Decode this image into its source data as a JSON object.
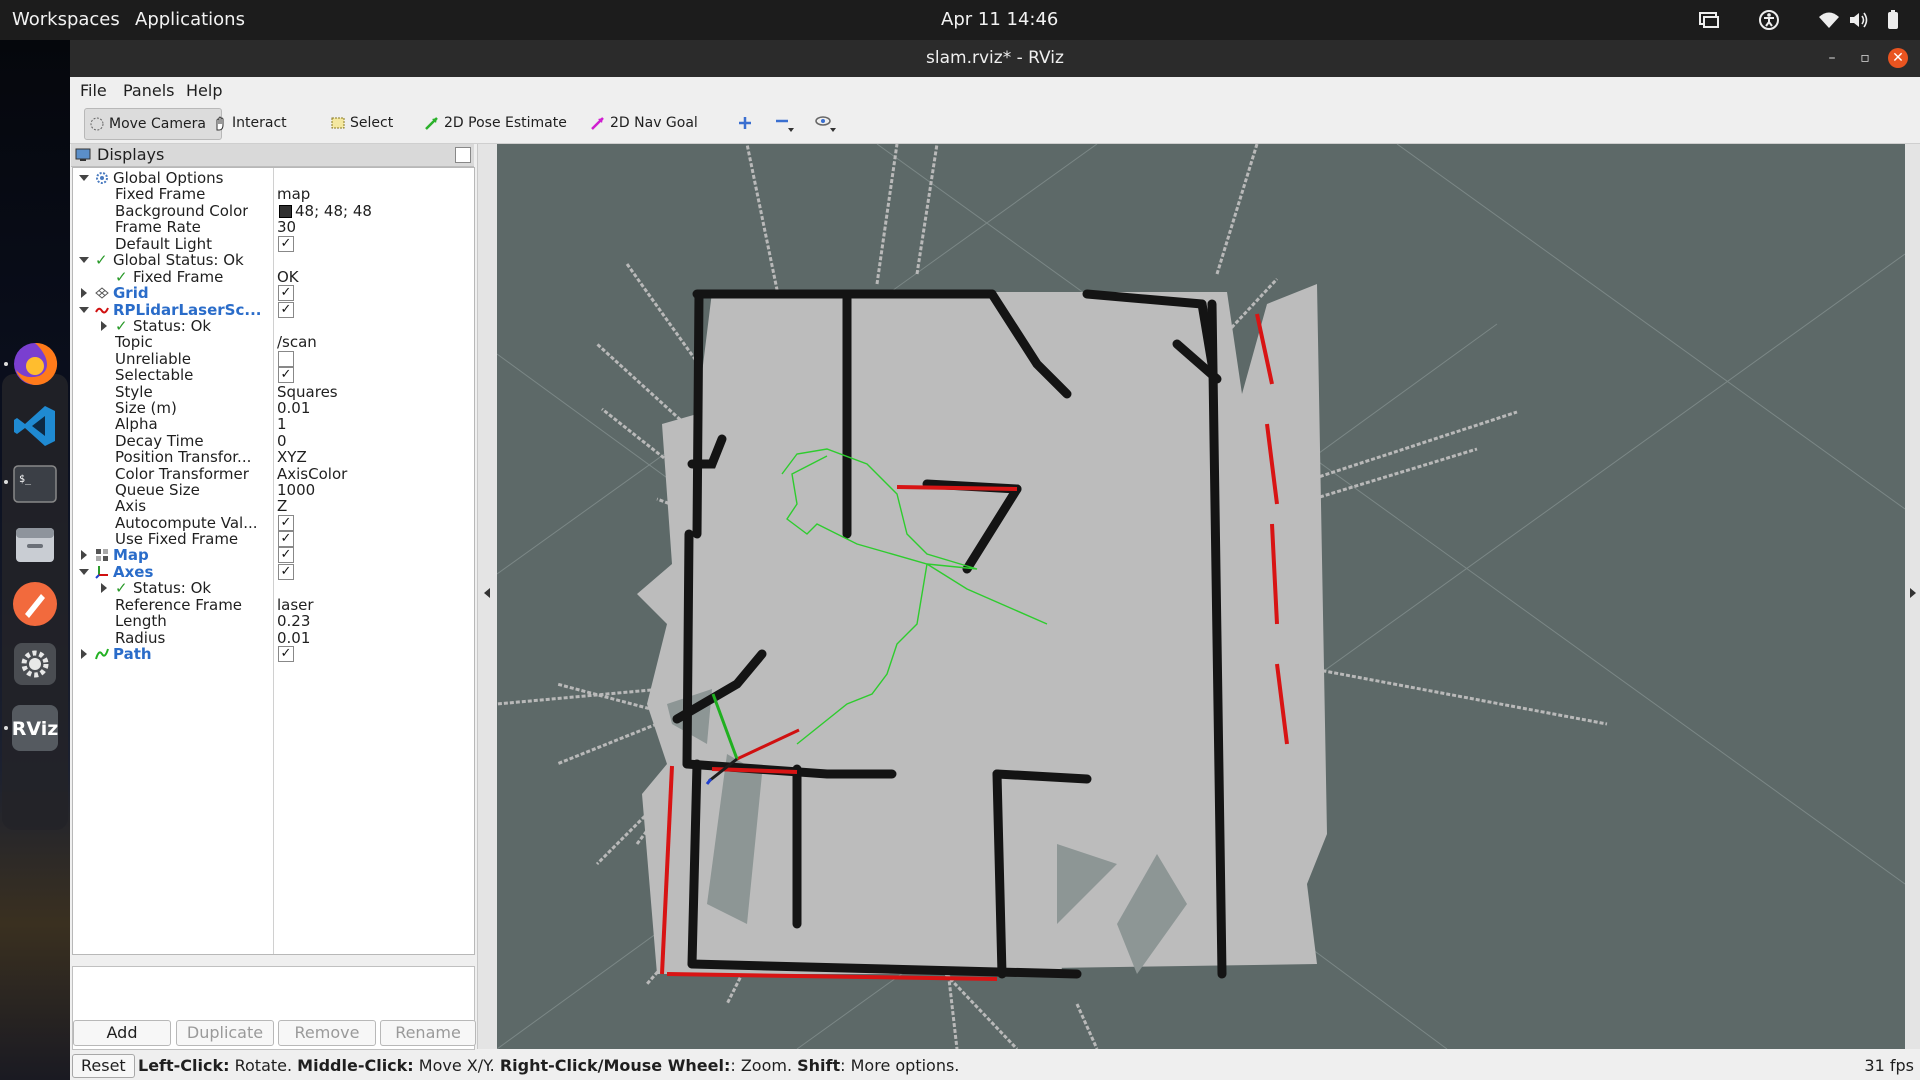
{
  "topbar": {
    "workspaces": "Workspaces",
    "applications": "Applications",
    "clock": "Apr 11  14:46"
  },
  "window": {
    "title": "slam.rviz* - RViz"
  },
  "menu": [
    "File",
    "Panels",
    "Help"
  ],
  "toolbar": {
    "move_camera": "Move Camera",
    "interact": "Interact",
    "select": "Select",
    "pose_estimate": "2D Pose Estimate",
    "nav_goal": "2D Nav Goal"
  },
  "displays": {
    "title": "Displays",
    "rows": {
      "global_options": "Global Options",
      "fixed_frame_lbl": "Fixed Frame",
      "fixed_frame_val": "map",
      "bg_color_lbl": "Background Color",
      "bg_color_val": "48; 48; 48",
      "frame_rate_lbl": "Frame Rate",
      "frame_rate_val": "30",
      "default_light_lbl": "Default Light",
      "global_status": "Global Status: Ok",
      "gs_fixed_frame_lbl": "Fixed Frame",
      "gs_fixed_frame_val": "OK",
      "grid": "Grid",
      "rplidar": "RPLidarLaserSc...",
      "status_ok": "Status: Ok",
      "topic_lbl": "Topic",
      "topic_val": "/scan",
      "unreliable_lbl": "Unreliable",
      "selectable_lbl": "Selectable",
      "style_lbl": "Style",
      "style_val": "Squares",
      "size_lbl": "Size (m)",
      "size_val": "0.01",
      "alpha_lbl": "Alpha",
      "alpha_val": "1",
      "decay_lbl": "Decay Time",
      "decay_val": "0",
      "pos_tf_lbl": "Position Transfor...",
      "pos_tf_val": "XYZ",
      "color_tf_lbl": "Color Transformer",
      "color_tf_val": "AxisColor",
      "queue_lbl": "Queue Size",
      "queue_val": "1000",
      "axis_lbl": "Axis",
      "axis_val": "Z",
      "autocompute_lbl": "Autocompute Val...",
      "use_fixed_lbl": "Use Fixed Frame",
      "map": "Map",
      "axes": "Axes",
      "axes_status": "Status: Ok",
      "ref_frame_lbl": "Reference Frame",
      "ref_frame_val": "laser",
      "length_lbl": "Length",
      "length_val": "0.23",
      "radius_lbl": "Radius",
      "radius_val": "0.01",
      "path": "Path"
    },
    "buttons": {
      "add": "Add",
      "duplicate": "Duplicate",
      "remove": "Remove",
      "rename": "Rename"
    }
  },
  "status": {
    "reset": "Reset",
    "b1": "Left-Click:",
    "t1": " Rotate. ",
    "b2": "Middle-Click:",
    "t2": " Move X/Y. ",
    "b3": "Right-Click/Mouse Wheel:",
    "t3": ": Zoom. ",
    "b4": "Shift",
    "t4": ": More options.",
    "fps": "31 fps"
  },
  "colors": {
    "view_bg": "#5d6968",
    "map_free": "#bcbcbc",
    "wall": "#111111",
    "scan": "#d01010",
    "path": "#22cc22"
  }
}
